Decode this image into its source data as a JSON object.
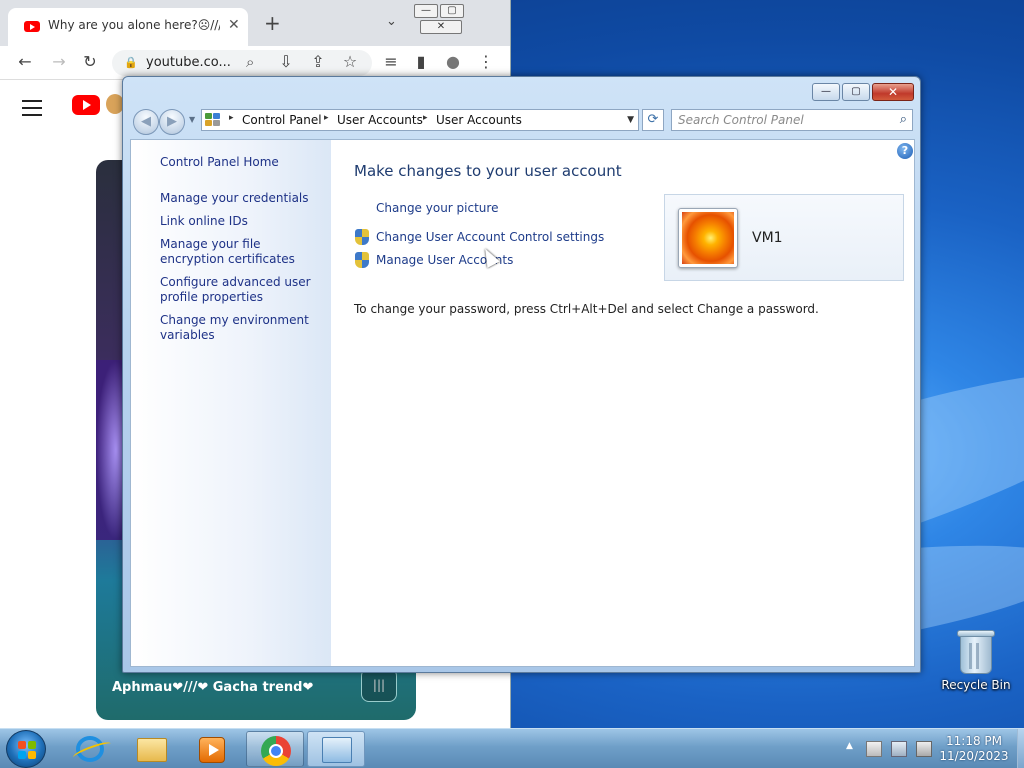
{
  "chrome": {
    "tab_title": "Why are you alone here?☹///❤",
    "tab_close": "✕",
    "new_tab": "+",
    "tab_search": "⌄",
    "window_controls": {
      "minimize": "—",
      "maximize": "▢",
      "close": "✕"
    },
    "toolbar": {
      "back": "←",
      "forward": "→",
      "reload": "↻",
      "lock": "🔒",
      "url": "youtube.co...",
      "zoom": "⌕",
      "install": "⇩",
      "share": "⇪",
      "bookmark": "☆",
      "media": "≡",
      "sidepanel": "▮",
      "profile": "●",
      "menu": "⋮"
    },
    "video_caption": "Aphmau❤///❤ Gacha trend❤",
    "sound_icon": "|||"
  },
  "control_panel": {
    "window_controls": {
      "minimize": "—",
      "maximize": "▢",
      "close": "✕"
    },
    "nav": {
      "back": "◀",
      "forward": "▶",
      "recent": "▼"
    },
    "breadcrumb": [
      "Control Panel",
      "User Accounts",
      "User Accounts"
    ],
    "breadcrumb_sep": "▸",
    "address_dropdown": "▼",
    "refresh": "⟳",
    "search": {
      "placeholder": "Search Control Panel",
      "icon": "⌕"
    },
    "sidebar": {
      "home": "Control Panel Home",
      "links": [
        "Manage your credentials",
        "Link online IDs",
        "Manage your file encryption certificates",
        "Configure advanced user profile properties",
        "Change my environment variables"
      ]
    },
    "help": "?",
    "main": {
      "title": "Make changes to your user account",
      "tasks": [
        "Change your picture",
        "Change User Account Control settings",
        "Manage User Accounts"
      ],
      "note": "To change your password, press Ctrl+Alt+Del and select Change a password."
    },
    "user": {
      "name": "VM1"
    }
  },
  "desktop": {
    "recycle_bin": "Recycle Bin"
  },
  "taskbar": {
    "items": [
      "internet-explorer",
      "windows-explorer",
      "media-player",
      "google-chrome",
      "control-panel"
    ],
    "tray_expand": "▲",
    "clock": {
      "time": "11:18 PM",
      "date": "11/20/2023"
    }
  }
}
